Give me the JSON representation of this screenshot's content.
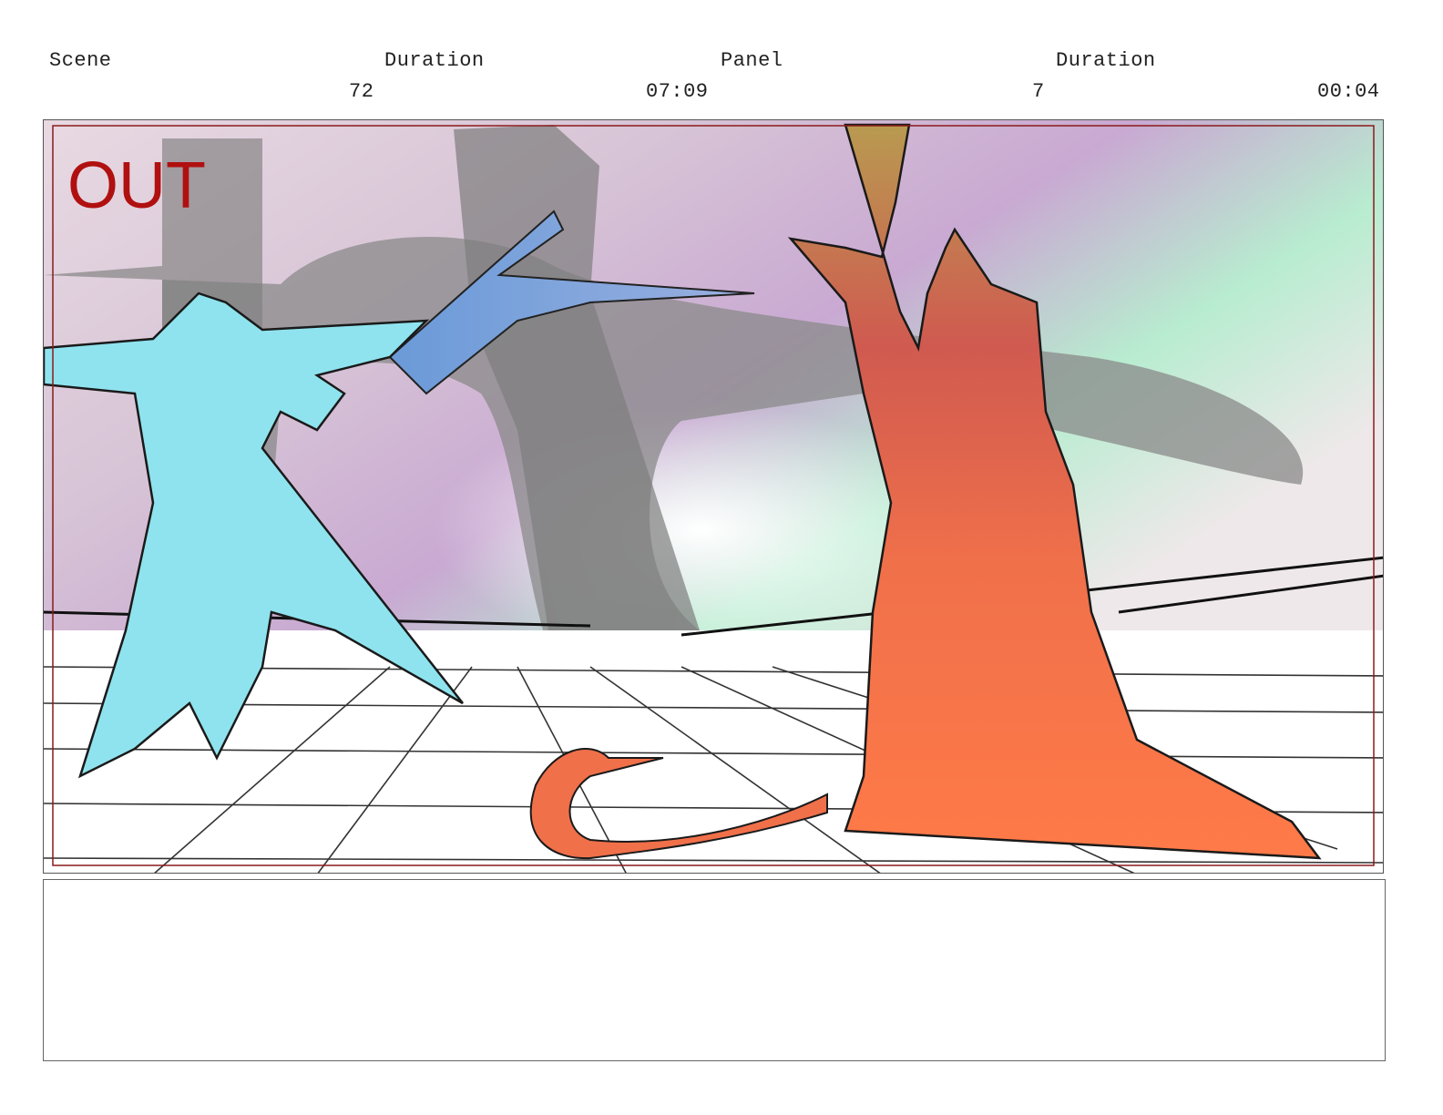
{
  "header": {
    "scene_label": "Scene",
    "scene_duration_label": "Duration",
    "panel_label": "Panel",
    "panel_duration_label": "Duration",
    "scene_number": "72",
    "scene_duration": "07:09",
    "panel_number": "7",
    "panel_duration": "00:04"
  },
  "panel": {
    "overlay_text": "OUT",
    "overlay_color": "#b01010",
    "left_figure_color": "#8fe3ee",
    "right_figure_color": "#f0704a"
  },
  "notes": {
    "text": ""
  }
}
